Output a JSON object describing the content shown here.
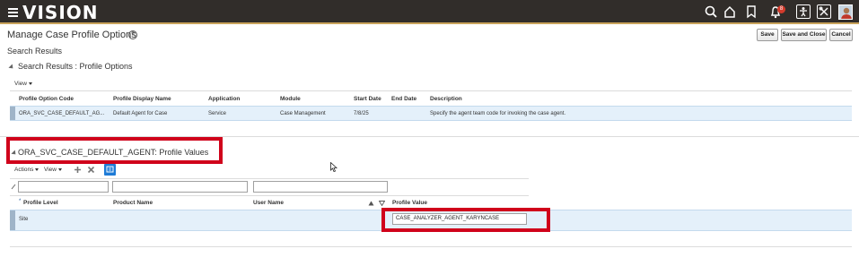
{
  "app": {
    "brand": "VISION",
    "notification_count": "8"
  },
  "page": {
    "title": "Manage Case Profile Options"
  },
  "actions": {
    "save": "Save",
    "save_close": "Save and Close",
    "cancel": "Cancel"
  },
  "search_results": {
    "heading": "Search Results",
    "subheading": "Search Results : Profile Options",
    "view_label": "View",
    "columns": [
      "Profile Option Code",
      "Profile Display Name",
      "Application",
      "Module",
      "Start Date",
      "End Date",
      "Description"
    ],
    "rows": [
      {
        "code": "ORA_SVC_CASE_DEFAULT_AG...",
        "display_name": "Default Agent for Case",
        "application": "Service",
        "module": "Case Management",
        "start_date": "7/8/25",
        "end_date": "",
        "description": "Specify the agent team code for invoking the case agent."
      }
    ]
  },
  "profile_values": {
    "heading": "ORA_SVC_CASE_DEFAULT_AGENT: Profile Values",
    "actions_label": "Actions",
    "view_label": "View",
    "columns": [
      "Profile Level",
      "Product Name",
      "User Name",
      "Profile Value"
    ],
    "required_marker": "*",
    "rows": [
      {
        "profile_level": "Site",
        "product_name": "",
        "user_name": "",
        "profile_value": "CASE_ANALYZER_AGENT_KARYNCASE"
      }
    ]
  },
  "colors": {
    "topbar": "#312d2a",
    "accent_line": "#c9a35b",
    "highlight": "#d0021b",
    "selected_row": "#e4f0fa"
  }
}
